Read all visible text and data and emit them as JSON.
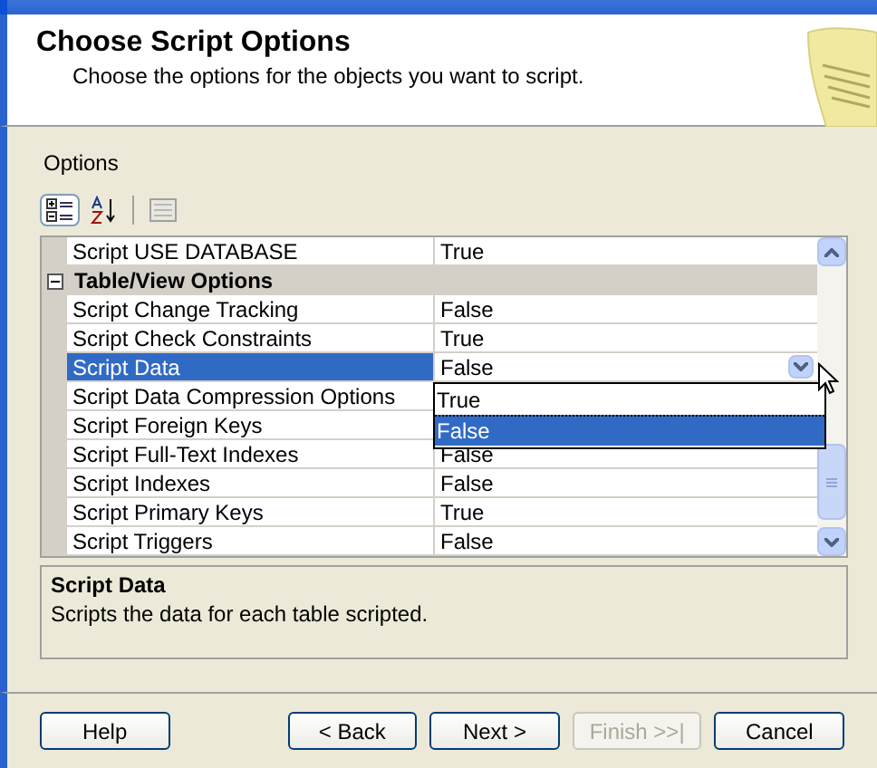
{
  "header": {
    "title": "Choose Script Options",
    "subtitle": "Choose the options for the objects you want to script."
  },
  "options_label": "Options",
  "toolbar": [
    {
      "kind": "categorized",
      "selected": true
    },
    {
      "kind": "alphabetical",
      "selected": false
    },
    {
      "kind": "pages",
      "selected": false
    }
  ],
  "grid": {
    "rows": [
      {
        "kind": "property",
        "name": "Script USE DATABASE",
        "value": "True",
        "selected": false
      },
      {
        "kind": "category",
        "name": "Table/View Options",
        "expanded": true
      },
      {
        "kind": "property",
        "name": "Script Change Tracking",
        "value": "False",
        "selected": false
      },
      {
        "kind": "property",
        "name": "Script Check Constraints",
        "value": "True",
        "selected": false
      },
      {
        "kind": "property",
        "name": "Script Data",
        "value": "False",
        "selected": true
      },
      {
        "kind": "property",
        "name": "Script Data Compression Options",
        "selected": false
      },
      {
        "kind": "property",
        "name": "Script Foreign Keys",
        "selected": false
      },
      {
        "kind": "property",
        "name": "Script Full-Text Indexes",
        "value": "False",
        "selected": false
      },
      {
        "kind": "property",
        "name": "Script Indexes",
        "value": "False",
        "selected": false
      },
      {
        "kind": "property",
        "name": "Script Primary Keys",
        "value": "True",
        "selected": false
      },
      {
        "kind": "property",
        "name": "Script Triggers",
        "value": "False",
        "selected": false
      }
    ],
    "dropdown": {
      "options": [
        {
          "label": "True",
          "selected": false
        },
        {
          "label": "False",
          "selected": true
        }
      ]
    }
  },
  "description": {
    "title": "Script Data",
    "text": "Scripts the data for each table scripted."
  },
  "buttons": [
    {
      "label": "Help",
      "disabled": false
    },
    {
      "label": "< Back",
      "disabled": false
    },
    {
      "label": "Next >",
      "disabled": false
    },
    {
      "label": "Finish >>|",
      "disabled": true
    },
    {
      "label": "Cancel",
      "disabled": false
    }
  ]
}
